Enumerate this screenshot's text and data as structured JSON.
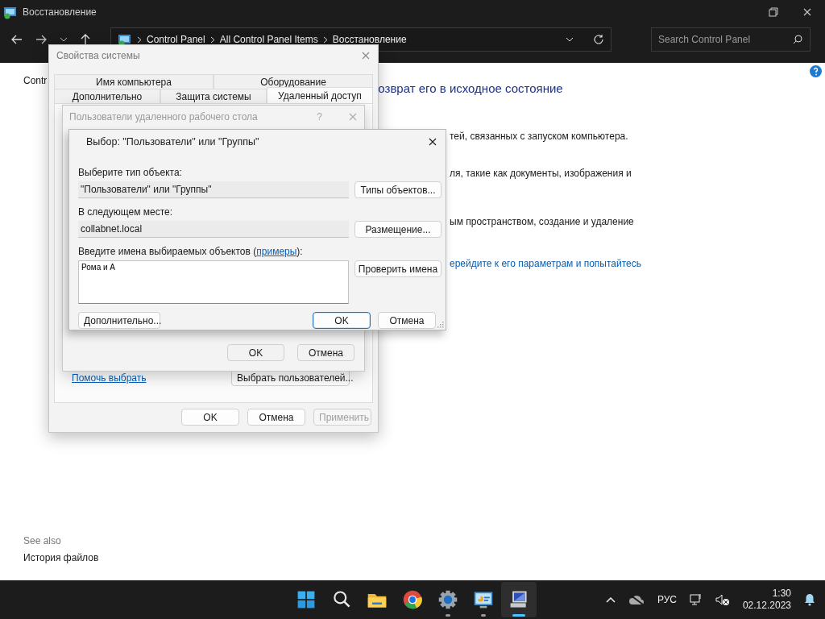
{
  "window": {
    "title": "Восстановление",
    "breadcrumbs": [
      "Control Panel",
      "All Control Panel Items",
      "Восстановление"
    ],
    "search": {
      "placeholder": "Search Control Panel"
    }
  },
  "content": {
    "side_link": "Contr",
    "heading": "озврат его в исходное состояние",
    "paragraphs": [
      "тей, связанных с запуском компьютера.",
      "ля, такие как документы, изображения и",
      "ым пространством, создание и удаление"
    ],
    "link": "ерейдите к его параметрам и попытайтесь",
    "see_also": {
      "title": "See also",
      "items": [
        "История файлов"
      ]
    }
  },
  "system_properties": {
    "title": "Свойства системы",
    "tab_rows": [
      {
        "tabs": [
          {
            "label": "Имя компьютера",
            "selected": false
          },
          {
            "label": "Оборудование",
            "selected": false
          }
        ]
      },
      {
        "tabs": [
          {
            "label": "Дополнительно",
            "selected": false
          },
          {
            "label": "Защита системы",
            "selected": false
          },
          {
            "label": "Удаленный доступ",
            "selected": true
          }
        ]
      }
    ],
    "help_link": "Помочь выбрать",
    "select_button": "Выбрать пользователей...",
    "buttons": [
      {
        "label": "OK",
        "disabled": false
      },
      {
        "label": "Отмена",
        "disabled": false
      },
      {
        "label": "Применить",
        "disabled": true
      }
    ]
  },
  "remote_users": {
    "title": "Пользователи удаленного рабочего стола",
    "help": "?",
    "buttons": [
      "OK",
      "Отмена"
    ]
  },
  "select_dialog": {
    "title": "Выбор: \"Пользователи\" или \"Группы\"",
    "object_type": {
      "label": "Выберите тип объекта:",
      "value": "\"Пользователи\" или \"Группы\"",
      "button": "Типы объектов..."
    },
    "location": {
      "label": "В следующем месте:",
      "value": "collabnet.local",
      "button": "Размещение..."
    },
    "names": {
      "label_before": "Введите имена выбираемых объектов (",
      "link": "примеры",
      "label_after": "):",
      "value": "Рома и А",
      "button": "Проверить имена"
    },
    "advanced_button": "Дополнительно...",
    "buttons": [
      {
        "label": "OK",
        "default": true
      },
      {
        "label": "Отмена",
        "default": false
      }
    ]
  },
  "taskbar": {
    "apps": [
      {
        "kind": "start",
        "running": false,
        "selected": false
      },
      {
        "kind": "search",
        "running": false,
        "selected": false
      },
      {
        "kind": "files",
        "running": false,
        "selected": false
      },
      {
        "kind": "browser",
        "running": false,
        "selected": false
      },
      {
        "kind": "settings",
        "running": true,
        "selected": false
      },
      {
        "kind": "control-panel",
        "running": true,
        "selected": false
      },
      {
        "kind": "system",
        "running": true,
        "selected": true
      }
    ],
    "language": "РУС",
    "time": "1:30",
    "date": "02.12.2023"
  }
}
